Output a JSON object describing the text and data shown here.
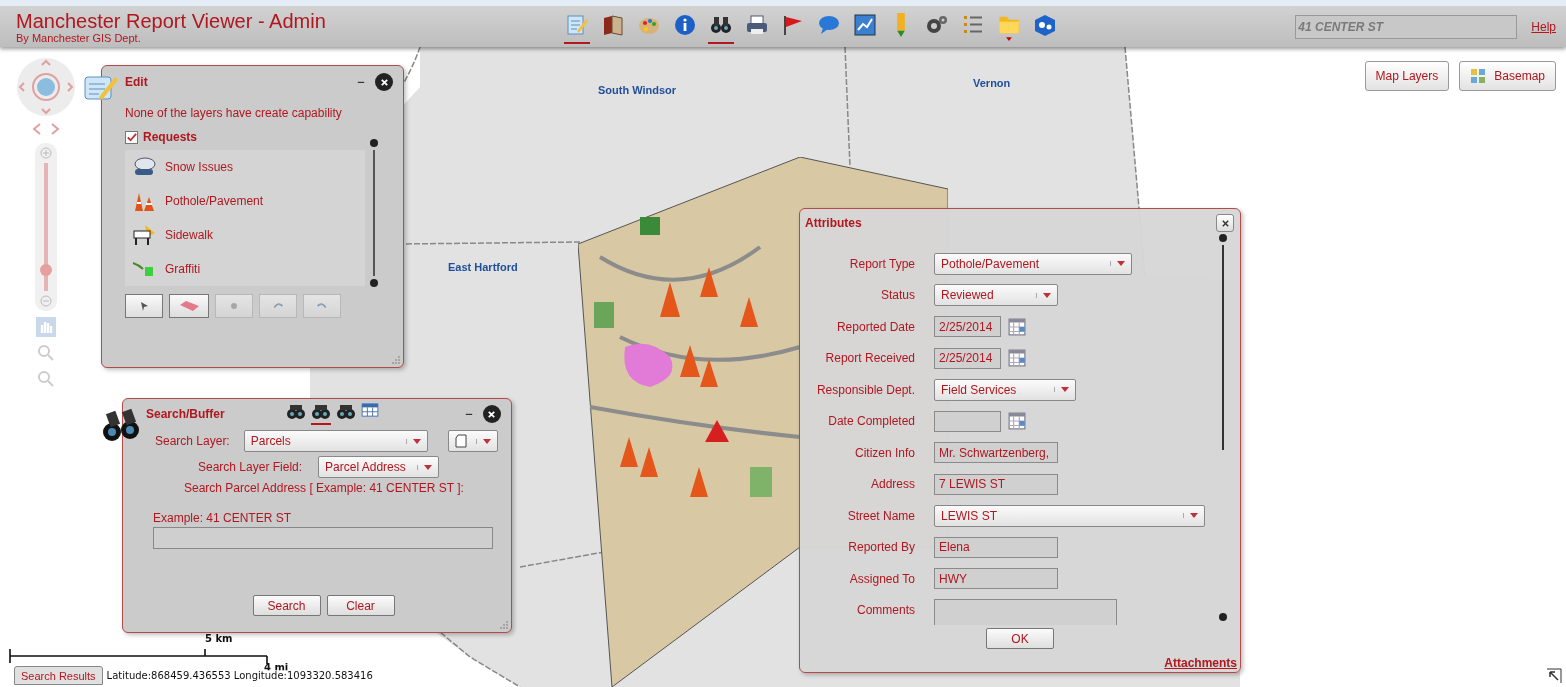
{
  "app": {
    "title": "Manchester Report Viewer - Admin",
    "subtitle": "By Manchester GIS Dept."
  },
  "toolbar": [
    {
      "kind": "edit",
      "selected": true
    },
    {
      "kind": "book",
      "selected": false
    },
    {
      "kind": "palette",
      "selected": false
    },
    {
      "kind": "info",
      "selected": false
    },
    {
      "kind": "binoculars",
      "selected": true
    },
    {
      "kind": "printer",
      "selected": false
    },
    {
      "kind": "flag",
      "selected": false
    },
    {
      "kind": "bubble",
      "selected": false
    },
    {
      "kind": "chart",
      "selected": false
    },
    {
      "kind": "pen",
      "selected": false
    },
    {
      "kind": "gears",
      "selected": false
    },
    {
      "kind": "list",
      "selected": false
    },
    {
      "kind": "folder",
      "selected": false
    },
    {
      "kind": "cube",
      "selected": false
    }
  ],
  "search": {
    "placeholder": "41 CENTER ST"
  },
  "help": "Help",
  "map": {
    "labels": [
      {
        "text": "South Windsor"
      },
      {
        "text": "Vernon"
      },
      {
        "text": "East Hartford"
      }
    ],
    "buttons": [
      {
        "label": "Map Layers",
        "kind": "text"
      },
      {
        "label": "Basemap",
        "kind": "basemap"
      }
    ],
    "zoom": {
      "level": 0.12
    },
    "scale": {
      "metric": "5 km",
      "imperial": "4 mi"
    },
    "results_button": "Search Results",
    "coordinates": "Latitude:868459.436553 Longitude:1093320.583416"
  },
  "edit_panel": {
    "title": "Edit",
    "message": "None of the layers have create capability",
    "layer": {
      "name": "Requests",
      "checked": true
    },
    "items": [
      {
        "label": "Snow Issues",
        "kind": "snow"
      },
      {
        "label": "Pothole/Pavement",
        "kind": "cones"
      },
      {
        "label": "Sidewalk",
        "kind": "sidewalk"
      },
      {
        "label": "Graffiti",
        "kind": "graffiti"
      }
    ],
    "tools": [
      {
        "kind": "select",
        "disabled": false
      },
      {
        "kind": "eraser",
        "disabled": false
      },
      {
        "kind": "point",
        "disabled": true
      },
      {
        "kind": "undo",
        "disabled": true
      },
      {
        "kind": "redo",
        "disabled": true
      }
    ]
  },
  "search_panel": {
    "title": "Search/Buffer",
    "tools": [
      {
        "kind": "binoculars",
        "selected": false
      },
      {
        "kind": "binoculars",
        "selected": true
      },
      {
        "kind": "binoculars",
        "selected": false
      },
      {
        "kind": "table",
        "selected": false
      }
    ],
    "layer_label": "Search Layer:",
    "layer_value": "Parcels",
    "field_label": "Search Layer Field:",
    "field_value": "Parcel Address",
    "prompt": "Search Parcel Address [ Example: 41 CENTER ST ]:",
    "input_label": "Example: 41 CENTER ST",
    "buttons": [
      "Search",
      "Clear"
    ]
  },
  "attributes": {
    "title": "Attributes",
    "fields": [
      {
        "label": "Report Type",
        "kind": "select",
        "value": "Pothole/Pavement"
      },
      {
        "label": "Status",
        "kind": "select",
        "value": "Reviewed"
      },
      {
        "label": "Reported Date",
        "kind": "date",
        "value": "2/25/2014"
      },
      {
        "label": "Report Received",
        "kind": "date",
        "value": "2/25/2014"
      },
      {
        "label": "Responsible Dept.",
        "kind": "select",
        "value": "Field Services"
      },
      {
        "label": "Date Completed",
        "kind": "date"
      },
      {
        "label": "Citizen Info",
        "kind": "text",
        "value": "Mr. Schwartzenberg,"
      },
      {
        "label": "Address",
        "kind": "text",
        "value": "7 LEWIS ST"
      },
      {
        "label": "Street Name",
        "kind": "select",
        "value": "LEWIS ST"
      },
      {
        "label": "Reported By",
        "kind": "text",
        "value": "Elena"
      },
      {
        "label": "Assigned To",
        "kind": "text",
        "value": "HWY"
      },
      {
        "label": "Comments",
        "kind": "textarea"
      }
    ],
    "ok": "OK",
    "link": "Attachments"
  }
}
